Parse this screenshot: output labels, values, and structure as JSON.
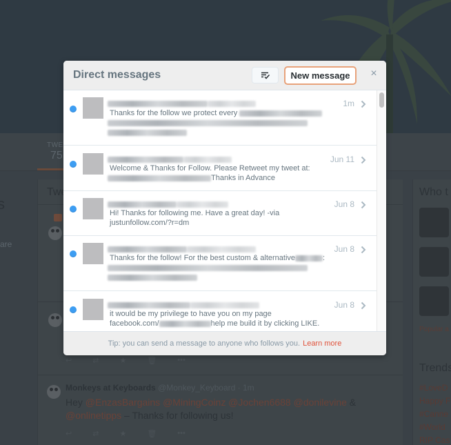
{
  "background": {
    "profile_nav": {
      "tweets_label": "TWEETS",
      "tweets_count": "75"
    },
    "left_col_fragment": "s",
    "left_col_fragment2": "are",
    "timeline_title": "Twe",
    "tweet": {
      "author_name": "Monkeys at Keyboards",
      "author_handle": "@Monkey_Keyboard · 1m",
      "text_prefix": "Hey ",
      "mentions": [
        "@EnzasBargains",
        "@MiningCoinz",
        "@Jochen6688",
        "@donilevine"
      ],
      "amp": " & ",
      "last_mention": "@onlinetipps",
      "text_suffix": " – Thanks for following us!"
    },
    "who_to_follow_title": "Who t",
    "popular_label": "Popular a",
    "trends_title": "Trends",
    "trends": [
      "#LoveD",
      "Happy F",
      "#Canne",
      "#World",
      "RIP Cas"
    ]
  },
  "modal": {
    "title": "Direct messages",
    "mark_all_read_icon": "mark-read-icon",
    "new_message_label": "New message",
    "close_label": "×",
    "accent_color": "#e8a27a",
    "unread_color": "#3d9df2",
    "messages": [
      {
        "time": "1m",
        "text": "Thanks for the follow we protect every",
        "unread": true
      },
      {
        "time": "Jun 11",
        "text": "Welcome & Thanks for Follow. Please Retweet my tweet at:",
        "text2": "Thanks in Advance",
        "unread": true
      },
      {
        "time": "Jun 8",
        "text": "Hi! Thanks for following me. Have a great day! -via",
        "text2": "justunfollow.com/?r=dm",
        "unread": true
      },
      {
        "time": "Jun 8",
        "text": "Thanks for the follow! For the best custom & alternative",
        "text_tail": ":",
        "unread": true
      },
      {
        "time": "Jun 8",
        "text": "it would be my privilege to have you on my page",
        "text2_prefix": "facebook.com/",
        "text2_suffix": "help me build it by clicking LIKE.",
        "unread": true
      }
    ],
    "footer": {
      "tip": "Tip: you can send a message to anyone who follows you.",
      "link": "Learn more",
      "link_color": "#e0533c"
    }
  }
}
